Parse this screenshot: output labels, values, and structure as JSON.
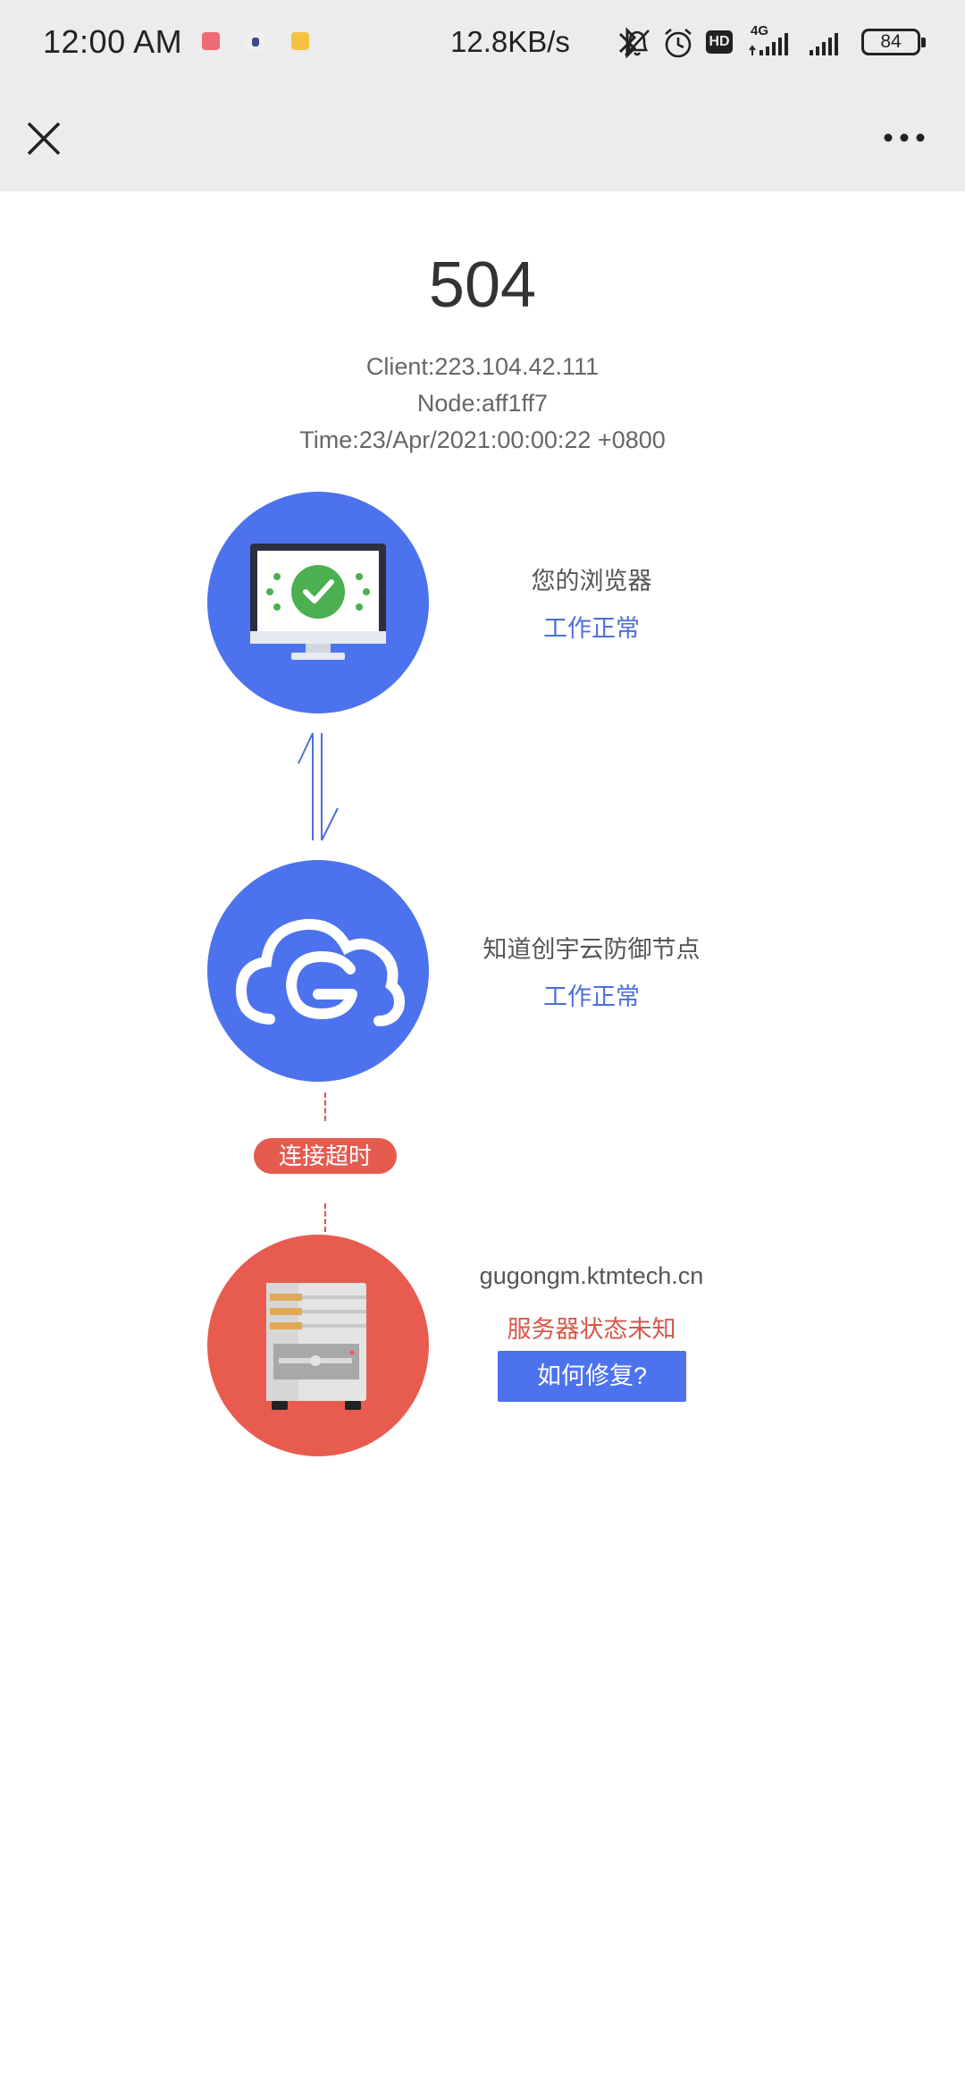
{
  "status_bar": {
    "time": "12:00 AM",
    "net_speed": "12.8KB/s",
    "network_type": "4G",
    "hd_label": "HD",
    "battery": "84",
    "notification_app_colors": [
      "#ef6b73",
      "#5c6bc0",
      "#f5c242"
    ]
  },
  "top_bar": {
    "close_icon": "close-icon",
    "more_icon": "more-icon"
  },
  "error": {
    "code": "504",
    "client": "Client:223.104.42.111",
    "node": "Node:aff1ff7",
    "time": "Time:23/Apr/2021:00:00:22 +0800"
  },
  "browser": {
    "name": "您的浏览器",
    "status": "工作正常"
  },
  "cdn_node": {
    "name": "知道创宇云防御节点",
    "status": "工作正常"
  },
  "connection": {
    "badge": "连接超时"
  },
  "server": {
    "host": "gugongm.ktmtech.cn",
    "status": "服务器状态未知",
    "fix_button": "如何修复?"
  },
  "colors": {
    "blue": "#4d72ee",
    "red": "#e85c4f",
    "status_ok": "#4d6fd8",
    "status_bad": "#d9564a"
  }
}
